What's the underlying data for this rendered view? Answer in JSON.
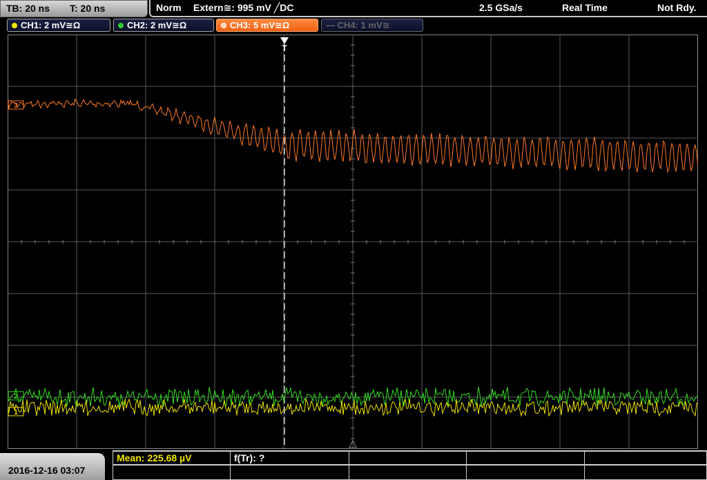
{
  "header": {
    "timebase": "TB: 20 ns",
    "trigger_time": "T: 20 ns",
    "mode": "Norm",
    "trigger_source": "Extern≅: 995 mV ╱DC",
    "sample_rate": "2.5 GSa/s",
    "acq_mode": "Real Time",
    "status": "Not Rdy."
  },
  "channels": [
    {
      "label": "CH1: 2 mV≅Ω",
      "color": "#f2e600",
      "state": "on"
    },
    {
      "label": "CH2: 2 mV≅Ω",
      "color": "#33cc33",
      "state": "on"
    },
    {
      "label": "CH3: 5 mV≅Ω",
      "color": "#ff7a26",
      "state": "selected"
    },
    {
      "label": "— CH4: 1 mV≅",
      "color": "#666666",
      "state": "off"
    }
  ],
  "markers": {
    "trigger": "T",
    "ch1": "1",
    "ch2": "2",
    "ch3": "3"
  },
  "footer": {
    "datetime": "2016-12-16 03:07",
    "meas1": "Mean: 225.68 µV",
    "meas2": "f(Tr): ?"
  },
  "colors": {
    "ch1": "#f2e600",
    "ch2": "#33dd22",
    "ch3": "#ff7a26",
    "grid": "#5a5a5a"
  }
}
